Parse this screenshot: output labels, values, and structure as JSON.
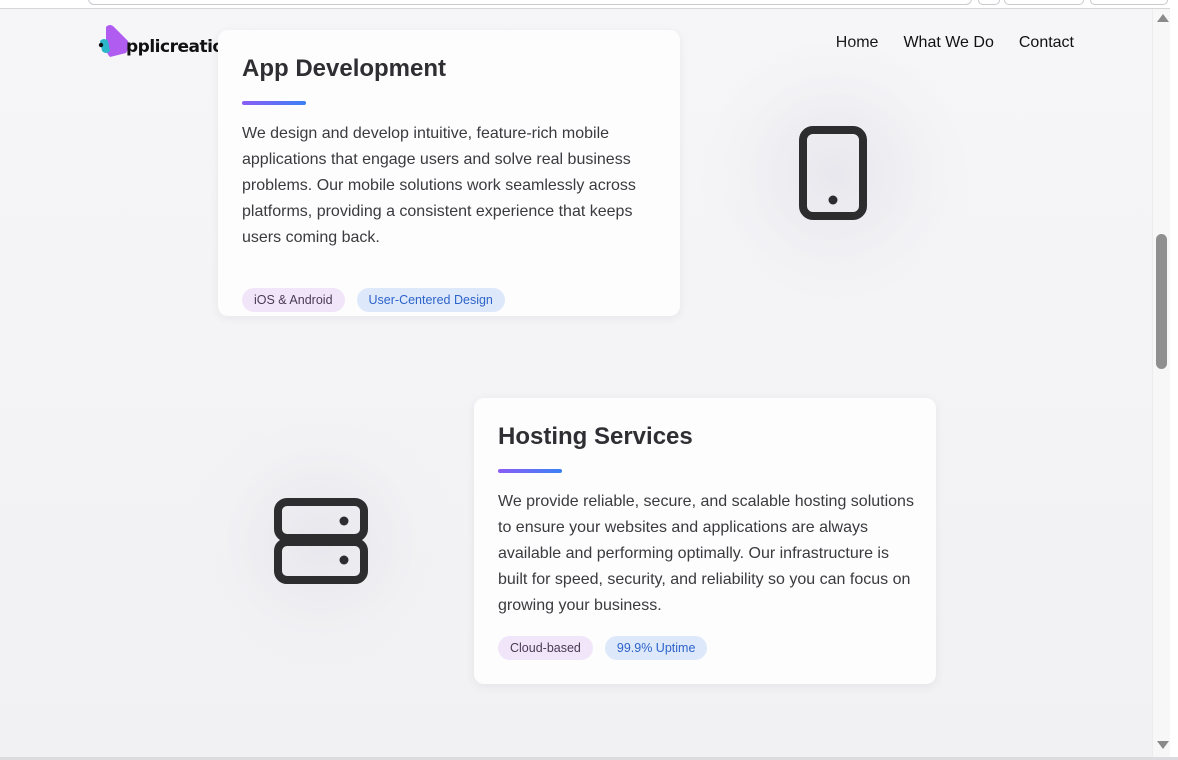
{
  "brand": {
    "logo_text": "pplicreations",
    "logo_label": "Applicreations"
  },
  "nav": {
    "items": [
      {
        "label": "Home"
      },
      {
        "label": "What We Do"
      },
      {
        "label": "Contact"
      }
    ]
  },
  "services": [
    {
      "title": "App Development",
      "description": "We design and develop intuitive, feature-rich mobile applications that engage users and solve real business problems. Our mobile solutions work seamlessly across platforms, providing a consistent experience that keeps users coming back.",
      "tags": [
        "iOS & Android",
        "User-Centered Design"
      ],
      "icon": "smartphone-icon"
    },
    {
      "title": "Hosting Services",
      "description": "We provide reliable, secure, and scalable hosting solutions to ensure your websites and applications are always available and performing optimally. Our infrastructure is built for speed, security, and reliability so you can focus on growing your business.",
      "tags": [
        "Cloud-based",
        "99.9% Uptime"
      ],
      "icon": "server-icon"
    }
  ],
  "theme": {
    "accent_start": "#8b5cf6",
    "accent_end": "#3b82f6",
    "tag_purple_bg": "#f1e6f9",
    "tag_blue_bg": "#dde9fb",
    "tag_blue_text": "#2e63c9"
  }
}
